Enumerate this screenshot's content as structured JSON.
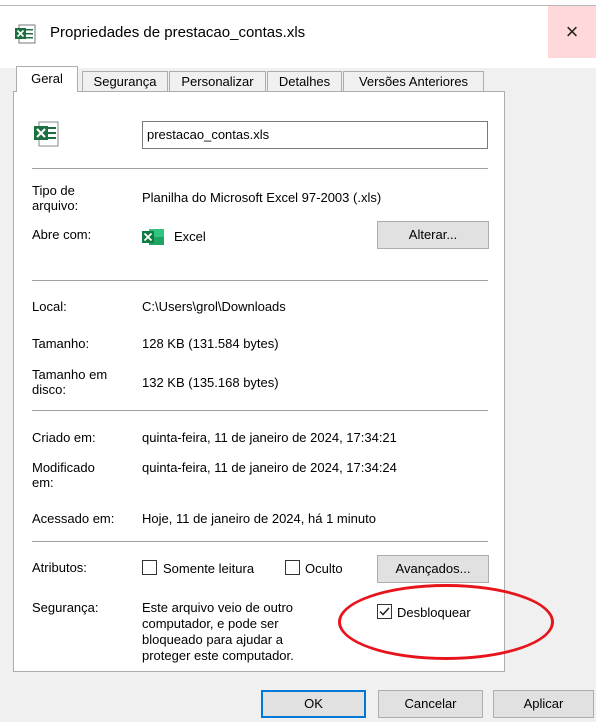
{
  "window": {
    "title": "Propriedades de prestacao_contas.xls",
    "close_glyph": "×"
  },
  "tabs": [
    {
      "label": "Geral",
      "active": true
    },
    {
      "label": "Segurança"
    },
    {
      "label": "Personalizar"
    },
    {
      "label": "Detalhes"
    },
    {
      "label": "Versões Anteriores"
    }
  ],
  "file": {
    "name": "prestacao_contas.xls",
    "icon": "excel-file-icon"
  },
  "props": {
    "tipo_label": "Tipo de arquivo:",
    "tipo_value": "Planilha do Microsoft Excel 97-2003 (.xls)",
    "abre_label": "Abre com:",
    "abre_value": "Excel",
    "alterar_button": "Alterar...",
    "local_label": "Local:",
    "local_value": "C:\\Users\\grol\\Downloads",
    "tamanho_label": "Tamanho:",
    "tamanho_value": "128 KB (131.584 bytes)",
    "disco_label": "Tamanho em disco:",
    "disco_value": "132 KB (135.168 bytes)",
    "criado_label": "Criado em:",
    "criado_value": "quinta-feira, 11 de janeiro de 2024, 17:34:21",
    "modificado_label": "Modificado em:",
    "modificado_value": "quinta-feira, 11 de janeiro de 2024, 17:34:24",
    "acessado_label": "Acessado em:",
    "acessado_value": "Hoje, 11 de janeiro de 2024, há 1 minuto",
    "atributos_label": "Atributos:",
    "somente_leitura": "Somente leitura",
    "somente_leitura_checked": false,
    "oculto": "Oculto",
    "oculto_checked": false,
    "avancados_button": "Avançados...",
    "seguranca_label": "Segurança:",
    "seguranca_text_1": "Este arquivo veio de outro",
    "seguranca_text_2": "computador, e pode ser",
    "seguranca_text_3": "bloqueado para ajudar a",
    "seguranca_text_4": "proteger este computador.",
    "desbloquear": "Desbloquear",
    "desbloquear_checked": true
  },
  "footer": {
    "ok": "OK",
    "cancelar": "Cancelar",
    "aplicar": "Aplicar"
  },
  "colors": {
    "accent": "#0078d7",
    "highlight": "#e8141c",
    "excel_green": "#1d6f42"
  }
}
